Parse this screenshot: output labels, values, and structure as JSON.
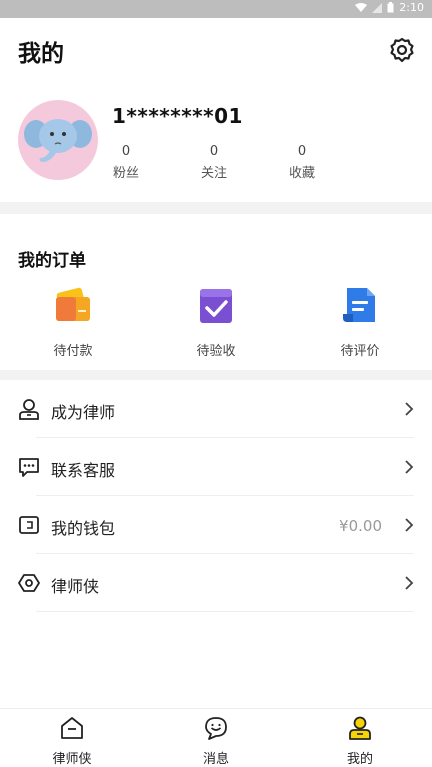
{
  "status_bar": {
    "time": "2:10"
  },
  "header": {
    "title": "我的"
  },
  "profile": {
    "username": "1********01",
    "stats": [
      {
        "value": "0",
        "label": "粉丝"
      },
      {
        "value": "0",
        "label": "关注"
      },
      {
        "value": "0",
        "label": "收藏"
      }
    ]
  },
  "orders": {
    "title": "我的订单",
    "items": [
      {
        "label": "待付款",
        "icon": "wallet-card-icon"
      },
      {
        "label": "待验收",
        "icon": "checkbox-icon"
      },
      {
        "label": "待评价",
        "icon": "document-icon"
      }
    ]
  },
  "menu": {
    "items": [
      {
        "label": "成为律师",
        "icon": "person-icon",
        "value": ""
      },
      {
        "label": "联系客服",
        "icon": "chat-icon",
        "value": ""
      },
      {
        "label": "我的钱包",
        "icon": "wallet-icon",
        "value": "¥0.00"
      },
      {
        "label": "律师侠",
        "icon": "hexagon-icon",
        "value": ""
      }
    ]
  },
  "tabbar": {
    "items": [
      {
        "label": "律师侠",
        "icon": "home-icon",
        "active": false
      },
      {
        "label": "消息",
        "icon": "message-icon",
        "active": false
      },
      {
        "label": "我的",
        "icon": "profile-icon",
        "active": true
      }
    ]
  },
  "colors": {
    "accent_yellow": "#f5d20a",
    "divider": "#f2f2f2",
    "wallet_value": "#999999"
  }
}
